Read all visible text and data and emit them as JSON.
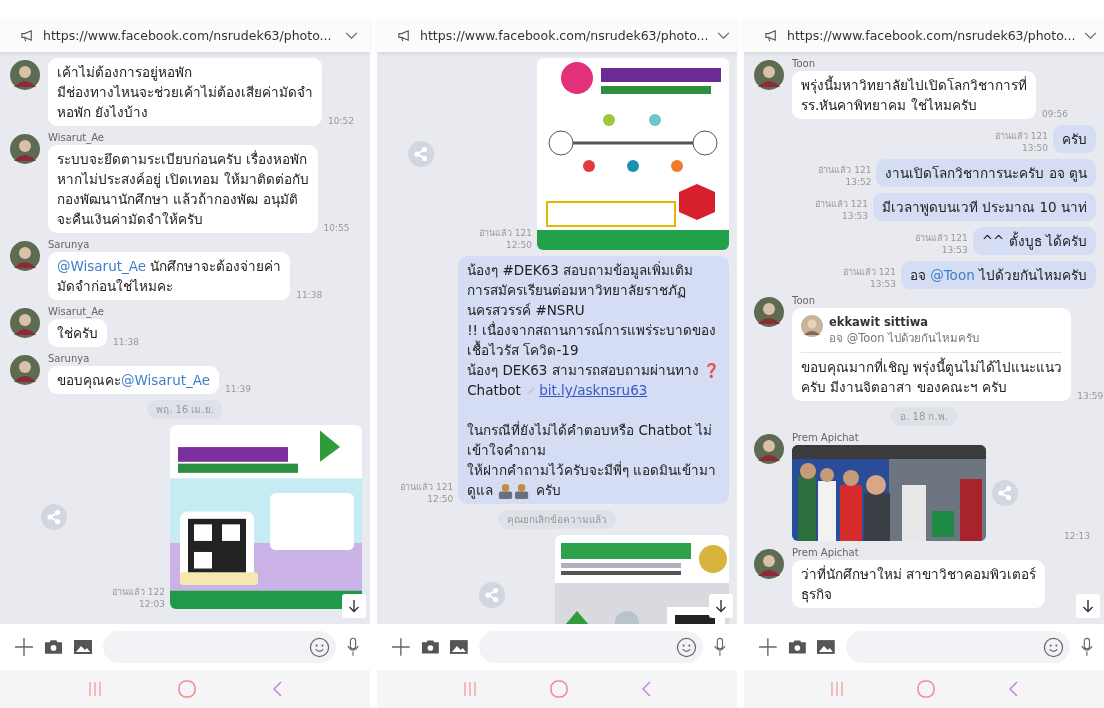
{
  "phones": [
    {
      "announcement": {
        "url": "https://www.facebook.com/nsrudek63/photo..."
      },
      "messages": [
        {
          "kind": "incoming",
          "parts": [
            {
              "kind": "text",
              "text": "เค้าไม่ต้องการอยู่หอพัก\nมีช่องทางไหนจะช่วยเค้าไม่ต้องเสียค่ามัดจำ\nหอพัก ยังไงบ้าง"
            }
          ],
          "time": "10:52"
        },
        {
          "kind": "incoming",
          "sender": "Wisarut_Ae",
          "parts": [
            {
              "kind": "text",
              "text": "ระบบจะยึดตามระเบียบก่อนครับ เรื่องหอพัก\nหากไม่ประสงค์อยู่ เปิดเทอม ให้มาติดต่อกับ\nกองพัฒนานักศึกษา  แล้วถ้ากองพัฒ อนุมัติ\nจะคืนเงินค่ามัดจำให้ครับ"
            }
          ],
          "time": "10:55"
        },
        {
          "kind": "incoming",
          "sender": "Sarunya",
          "parts": [
            {
              "kind": "mention",
              "text": "@Wisarut_Ae"
            },
            {
              "kind": "text",
              "text": "  นักศึกษาจะต้องจ่ายค่า\nมัดจำก่อนใช่ไหมคะ"
            }
          ],
          "time": "11:38"
        },
        {
          "kind": "incoming",
          "sender": "Wisarut_Ae",
          "parts": [
            {
              "kind": "text",
              "text": "ใช่ครับ"
            }
          ],
          "time": "11:38"
        },
        {
          "kind": "incoming",
          "sender": "Sarunya",
          "parts": [
            {
              "kind": "text",
              "text": "ขอบคุณคะ"
            },
            {
              "kind": "mention",
              "text": "@Wisarut_Ae"
            }
          ],
          "time": "11:39"
        },
        {
          "kind": "date",
          "text": "พฤ. 16 เม.ย."
        },
        {
          "kind": "outgoing_image",
          "read": "อ่านแล้ว 122",
          "time": "12:03"
        }
      ]
    },
    {
      "announcement": {
        "url": "https://www.facebook.com/nsrudek63/photo..."
      },
      "messages": [
        {
          "kind": "outgoing_image",
          "read": "อ่านแล้ว 121",
          "time": "12:50"
        },
        {
          "kind": "outgoing",
          "read": "อ่านแล้ว 121",
          "time": "12:50",
          "parts": [
            {
              "kind": "text",
              "text": "น้องๆ #DEK63 สอบถามข้อมูลเพิ่มเติม\nการสมัครเรียนต่อมหาวิทยาลัยราชภัฏ\nนครสวรรค์  #NSRU\n!! เนื่องจากสถานการณ์การแพร่ระบาดของ\nเชื้อไวรัส โควิด-19\nน้องๆ DEK63 สามารถสอบถามผ่านทาง "
            },
            {
              "kind": "alert",
              "text": "❓"
            },
            {
              "kind": "text",
              "text": "\nChatbot  "
            },
            {
              "kind": "link",
              "text": "bit.ly/asknsru63"
            },
            {
              "kind": "text",
              "text": "\n\nในกรณีที่ยังไม่ได้คำตอบหรือ Chatbot ไม่\nเข้าใจคำถาม\nให้ฝากคำถามไว้ครับจะมีพี่ๆ แอดมินเข้ามา\nดูแล "
            },
            {
              "kind": "emoji"
            },
            {
              "kind": "text",
              "text": " ครับ"
            }
          ]
        },
        {
          "kind": "notice",
          "text": "คุณยกเลิกข้อความแล้ว"
        },
        {
          "kind": "outgoing_image"
        }
      ]
    },
    {
      "announcement": {
        "url": "https://www.facebook.com/nsrudek63/photo..."
      },
      "messages": [
        {
          "kind": "incoming",
          "sender": "Toon",
          "parts": [
            {
              "kind": "text",
              "text": "พรุ่งนี้มหาวิทยาลัยไปเปิดโลกวิชาการที่\nรร.หันคาพิทยาคม ใช่ไหมครับ"
            }
          ],
          "time": "09:56"
        },
        {
          "kind": "outgoing",
          "read": "อ่านแล้ว 121",
          "time": "13:50",
          "parts": [
            {
              "kind": "text",
              "text": "ครับ"
            }
          ]
        },
        {
          "kind": "outgoing",
          "read": "อ่านแล้ว 121",
          "time": "13:52",
          "parts": [
            {
              "kind": "text",
              "text": "งานเปิดโลกวิชาการนะครับ อจ ตูน"
            }
          ]
        },
        {
          "kind": "outgoing",
          "read": "อ่านแล้ว 121",
          "time": "13:53",
          "parts": [
            {
              "kind": "text",
              "text": "มีเวลาพูดบนเวที ประมาณ 10 นาท่"
            }
          ]
        },
        {
          "kind": "outgoing",
          "read": "อ่านแล้ว 121",
          "time": "13:53",
          "parts": [
            {
              "kind": "text",
              "text": "^^ ตั้งบูธ ได้ครับ"
            }
          ]
        },
        {
          "kind": "outgoing",
          "read": "อ่านแล้ว 121",
          "time": "13:53",
          "parts": [
            {
              "kind": "text",
              "text": "อจ "
            },
            {
              "kind": "mention",
              "text": "@Toon"
            },
            {
              "kind": "text",
              "text": "  ไปด้วยกันไหมครับ"
            }
          ]
        },
        {
          "kind": "incoming",
          "sender": "Toon",
          "quote": {
            "author": "ekkawit sittiwa",
            "parts": [
              {
                "kind": "text",
                "text": "อจ @Toon  ไปด้วยกันไหมครับ"
              }
            ]
          },
          "parts": [
            {
              "kind": "text",
              "text": "ขอบคุณมากที่เชิญ พรุ่งนี้ตูนไม่ได้ไปแนะแนว\nครับ มีงานจิตอาสา ของคณะฯ ครับ"
            }
          ],
          "time": "13:59"
        },
        {
          "kind": "date",
          "text": "อ. 18 ก.พ."
        },
        {
          "kind": "incoming_image",
          "sender": "Prem Apichat",
          "time": "12:13"
        },
        {
          "kind": "incoming",
          "sender": "Prem Apichat",
          "parts": [
            {
              "kind": "text",
              "text": "ว่าที่นักศึกษาใหม่ สาขาวิชาคอมพิวเตอร์\nธุรกิจ"
            }
          ]
        }
      ]
    }
  ]
}
